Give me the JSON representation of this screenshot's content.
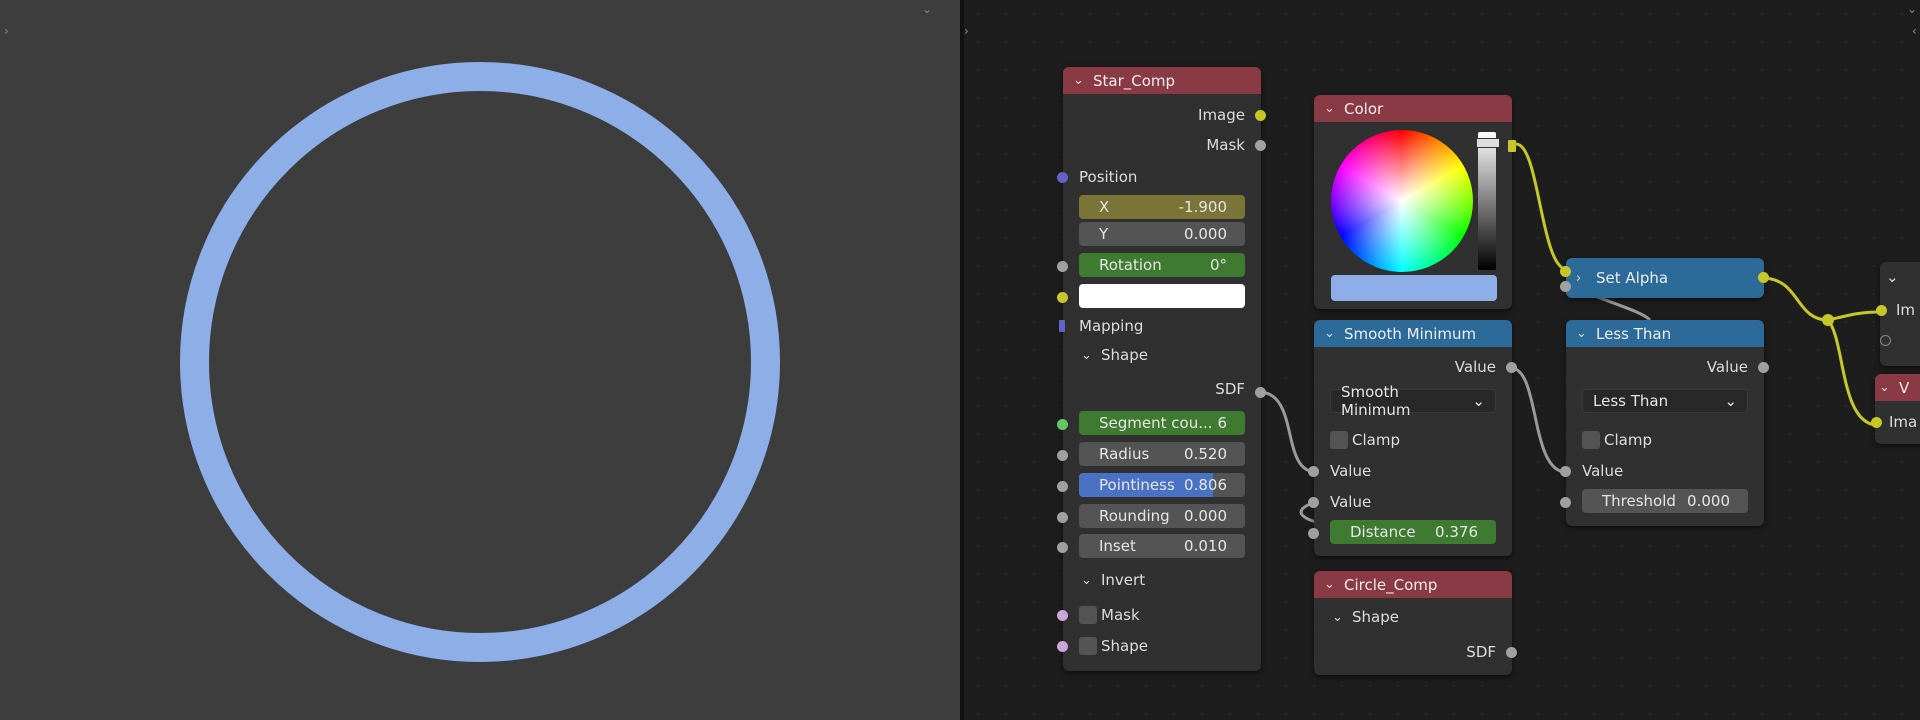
{
  "colors": {
    "ring": "#8eaee8",
    "node_header_red": "#8a3a44",
    "node_header_blue": "#2c6a9a",
    "socket_yellow": "#c7c729",
    "socket_gray": "#a0a0a0"
  },
  "star_comp": {
    "title": "Star_Comp",
    "outputs": {
      "image": "Image",
      "mask": "Mask"
    },
    "position_label": "Position",
    "x_label": "X",
    "x_value": "-1.900",
    "y_label": "Y",
    "y_value": "0.000",
    "rotation_label": "Rotation",
    "rotation_value": "0°",
    "mapping_label": "Mapping",
    "shape_panel": "Shape",
    "sdf_output": "SDF",
    "segment_label": "Segment cou...",
    "segment_value": "6",
    "radius_label": "Radius",
    "radius_value": "0.520",
    "pointiness_label": "Pointiness",
    "pointiness_value": "0.806",
    "rounding_label": "Rounding",
    "rounding_value": "0.000",
    "inset_label": "Inset",
    "inset_value": "0.010",
    "invert_panel": "Invert",
    "mask_label": "Mask",
    "shape_label": "Shape"
  },
  "color_node": {
    "title": "Color"
  },
  "smooth_min": {
    "title": "Smooth Minimum",
    "output": "Value",
    "mode": "Smooth Minimum",
    "clamp": "Clamp",
    "input1": "Value",
    "input2": "Value",
    "distance_label": "Distance",
    "distance_value": "0.376"
  },
  "circle_comp": {
    "title": "Circle_Comp",
    "shape_panel": "Shape",
    "sdf_output": "SDF"
  },
  "set_alpha": {
    "title": "Set Alpha"
  },
  "less_than": {
    "title": "Less Than",
    "output": "Value",
    "mode": "Less Than",
    "clamp": "Clamp",
    "input": "Value",
    "threshold_label": "Threshold",
    "threshold_value": "0.000"
  },
  "partial_nodes": {
    "top_input": "Im",
    "bottom_title": "V",
    "bottom_input": "Ima"
  }
}
